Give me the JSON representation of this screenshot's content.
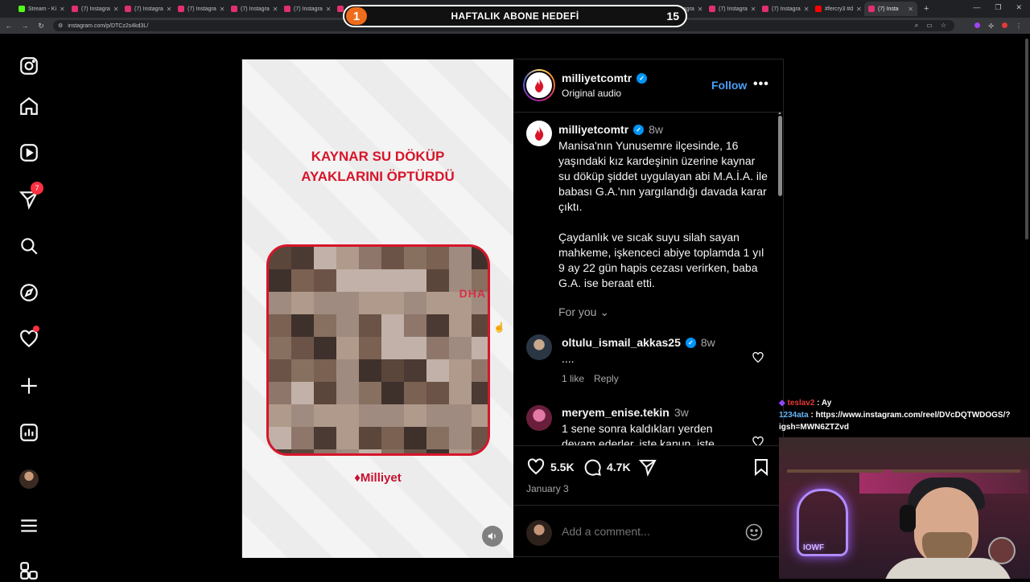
{
  "browser": {
    "tabs": [
      {
        "label": "Stream - Ki",
        "kind": "k"
      },
      {
        "label": "(7) Instagra",
        "kind": "ig"
      },
      {
        "label": "(7) Instagra",
        "kind": "ig"
      },
      {
        "label": "(7) Instagra",
        "kind": "ig"
      },
      {
        "label": "(7) Instagra",
        "kind": "ig"
      },
      {
        "label": "(7) Instagra",
        "kind": "ig"
      },
      {
        "label": "(7) Instagra",
        "kind": "ig"
      },
      {
        "label": "(7) Instagra",
        "kind": "ig"
      },
      {
        "label": "(7) Instagra",
        "kind": "ig"
      },
      {
        "label": "(7) Instagra",
        "kind": "ig"
      },
      {
        "label": "(7) Instagra",
        "kind": "ig"
      },
      {
        "label": "(7) Instagra",
        "kind": "ig"
      },
      {
        "label": "(7) Instagra",
        "kind": "ig"
      },
      {
        "label": "(7) Instagra",
        "kind": "ig"
      },
      {
        "label": "(7) Instagra",
        "kind": "ig"
      },
      {
        "label": "#fercry3 #d",
        "kind": "yt"
      },
      {
        "label": "(7) Insta",
        "kind": "ig",
        "active": true
      }
    ],
    "url": "instagram.com/p/DTCz2s4kd3L/"
  },
  "overlay": {
    "count": "1",
    "label": "HAFTALIK ABONE HEDEFİ",
    "goal": "15"
  },
  "sidebar": {
    "notification_count": "7"
  },
  "media": {
    "headline_line1": "KAYNAR SU DÖKÜP",
    "headline_line2": "AYAKLARINI ÖPTÜRDÜ",
    "watermark": "DHA",
    "brand": "Milliyet"
  },
  "post": {
    "username": "milliyetcomtr",
    "subtitle": "Original audio",
    "follow_label": "Follow",
    "more_label": "•••",
    "caption_time": "8w",
    "caption": "Manisa'nın Yunusemre ilçesinde, 16 yaşındaki kız kardeşinin üzerine kaynar su döküp şiddet uygulayan abi M.A.İ.A. ile babası G.A.'nın yargılandığı davada karar çıktı.\n\nÇaydanlık ve sıcak suyu silah sayan mahkeme, işkenceci abiye toplamda 1 yıl 9 ay 22 gün hapis cezası verirken, baba G.A. ise beraat etti.",
    "for_you": "For you",
    "comments": [
      {
        "user": "oltulu_ismail_akkas25",
        "verified": true,
        "time": "8w",
        "text": "....",
        "likes": "1 like",
        "reply": "Reply"
      },
      {
        "user": "meryem_enise.tekin",
        "verified": false,
        "time": "3w",
        "text": "1 sene sonra kaldıkları yerden devam ederler. işte kanun, işte",
        "likes": "",
        "reply": ""
      }
    ],
    "like_count": "5.5K",
    "comment_count": "4.7K",
    "date": "January 3",
    "comment_placeholder": "Add a comment..."
  },
  "chat": {
    "line1_user": "teslav2",
    "line1_text": " : Ay",
    "line2_user": "1234ata",
    "line2_text": " : https://www.instagram.com/reel/DVcDQTWDOGS/?igsh=MWN6ZTZvd"
  },
  "webcam": {
    "neon_text": "IOWF"
  },
  "colors": {
    "accent_blue": "#0095f6",
    "follow_blue": "#4a9ff5",
    "milliyet_red": "#d7152a",
    "badge_red": "#ff3040",
    "overlay_orange": "#ef6c1a"
  }
}
